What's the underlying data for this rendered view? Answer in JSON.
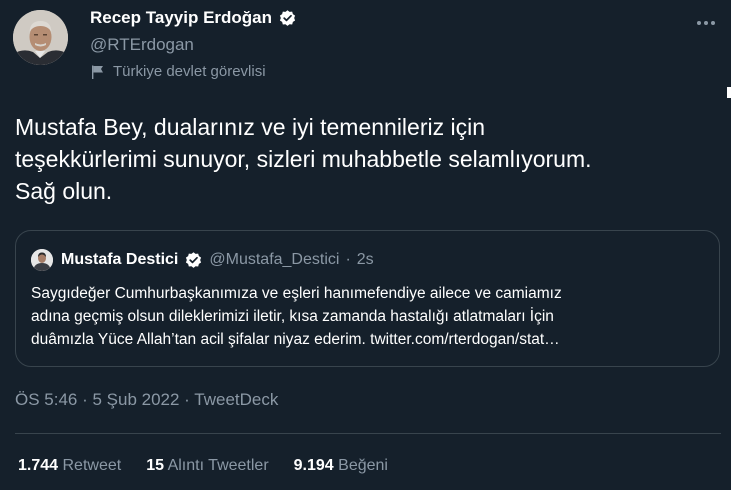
{
  "author": {
    "name": "Recep Tayyip Erdoğan",
    "handle": "@RTErdogan",
    "label": "Türkiye devlet görevlisi"
  },
  "tweet": {
    "text": "Mustafa Bey, dualarınız ve iyi temennileriz için teşekkürlerimi sunuyor, sizleri muhabbetle selamlıyorum. Sağ olun."
  },
  "quote": {
    "name": "Mustafa Destici",
    "handle": "@Mustafa_Destici",
    "separator": "·",
    "time": "2s",
    "lines": [
      "Saygıdeğer Cumhurbaşkanımıza ve eşleri hanımefendiye ailece ve camiamız",
      "adına geçmiş olsun dileklerimizi iletir, kısa zamanda hastalığı atlatmaları İçin",
      "duâmızla Yüce Allah’tan acil şifalar niyaz ederim. twitter.com/rterdogan/stat…"
    ]
  },
  "meta": {
    "time": "ÖS 5:46",
    "sep1": " · ",
    "date": "5 Şub 2022",
    "sep2": " · ",
    "source": "TweetDeck"
  },
  "stats": {
    "retweets_count": "1.744",
    "retweets_label": "Retweet",
    "quotes_count": "15",
    "quotes_label": "Alıntı Tweetler",
    "likes_count": "9.194",
    "likes_label": "Beğeni"
  },
  "colors": {
    "background": "#15202b",
    "secondary_text": "#8b98a5",
    "border": "#38444d",
    "verified": "#ffffff"
  }
}
